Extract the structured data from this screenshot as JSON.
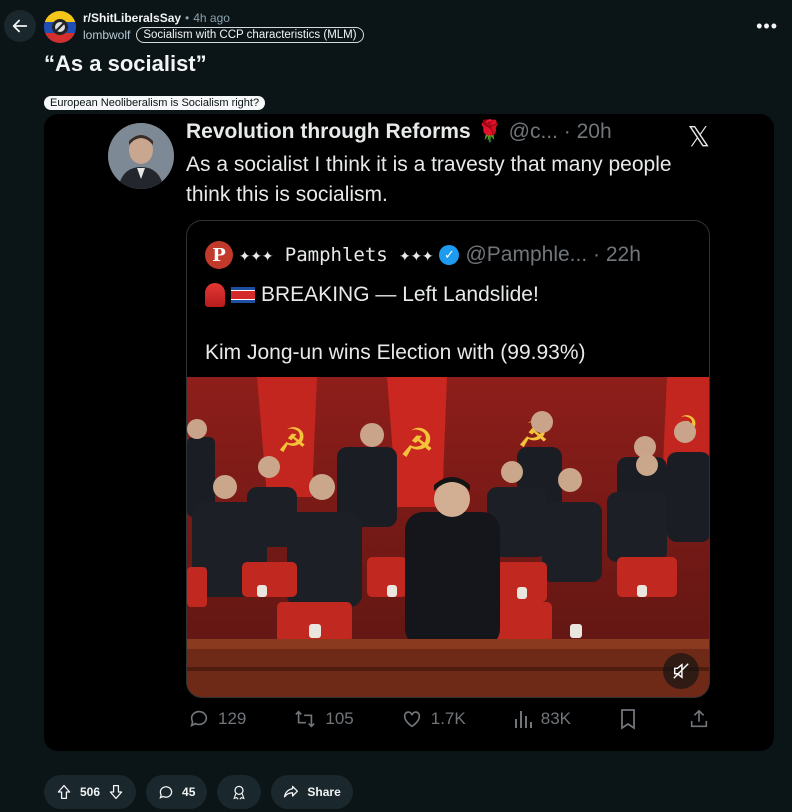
{
  "header": {
    "subreddit": "r/ShitLiberalsSay",
    "separator": "•",
    "time_ago": "4h ago",
    "author": "lombwolf",
    "user_flair": "Socialism with CCP characteristics (MLM)",
    "more_label": "•••"
  },
  "post": {
    "title": "“As a socialist”",
    "flair": "European Neoliberalism is Socialism right?"
  },
  "tweet": {
    "name": "Revolution through Reforms 🌹",
    "handle_time": "@c... · 20h",
    "x_logo": "𝕏",
    "text": "As a socialist I think it is a travesty that many people think this is socialism.",
    "quote": {
      "avatar_letter": "P",
      "name": "✦✦✦ Pamphlets ✦✦✦",
      "verified": "✓",
      "handle_time": "@Pamphle... · 22h",
      "line1": "BREAKING — Left Landslide!",
      "line2": "Kim Jong-un wins Election with (99.93%)"
    },
    "stats": {
      "replies": "129",
      "retweets": "105",
      "likes": "1.7K",
      "views": "83K"
    }
  },
  "bottom_bar": {
    "votes": "506",
    "comments": "45",
    "share": "Share"
  },
  "colors": {
    "background": "#0b1416",
    "pill": "#1a282d",
    "twitter_text": "#e7e9ea",
    "twitter_muted": "#71767b",
    "verified": "#1d9bf0"
  }
}
